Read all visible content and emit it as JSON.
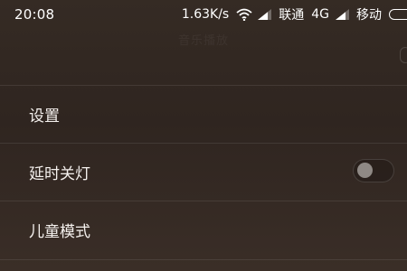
{
  "status_bar": {
    "time": "20:08",
    "speed": "1.63K/s",
    "carrier": "联通",
    "network": "4G",
    "carrier2": "移动",
    "icons": [
      "wifi-icon",
      "signal-icon",
      "signal-icon",
      "battery-icon"
    ]
  },
  "header": {
    "title": "音乐播放"
  },
  "menu": {
    "items": [
      {
        "label": "设置"
      },
      {
        "label": "延时关灯",
        "toggle": false
      },
      {
        "label": "儿童模式"
      }
    ]
  },
  "colors": {
    "background": "#2f2520",
    "text": "#f5f1ee",
    "toggle_knob": "#8f8985"
  }
}
